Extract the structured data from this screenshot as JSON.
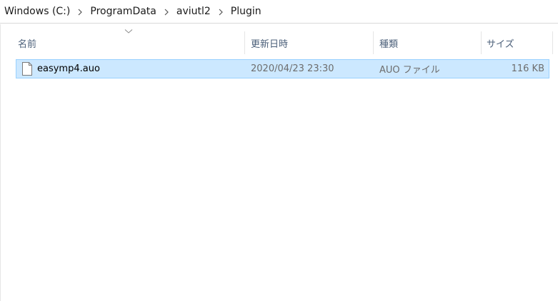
{
  "breadcrumb": {
    "items": [
      "Windows (C:)",
      "ProgramData",
      "aviutl2",
      "Plugin"
    ]
  },
  "columns": {
    "name": "名前",
    "date": "更新日時",
    "type": "種類",
    "size": "サイズ"
  },
  "files": [
    {
      "name": "easymp4.auo",
      "date": "2020/04/23 23:30",
      "type": "AUO ファイル",
      "size": "116 KB",
      "selected": true
    }
  ],
  "colors": {
    "selection_bg": "#cce8ff",
    "selection_border": "#99d1ff",
    "header_text": "#4c607a"
  },
  "icons": {
    "separator": "chevron-right-icon",
    "sort": "chevron-down-icon",
    "file": "file-icon"
  }
}
